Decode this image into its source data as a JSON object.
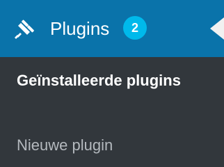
{
  "plugins_menu": {
    "label": "Plugins",
    "badge_count": "2",
    "icon": "plugin-icon",
    "submenu": {
      "installed": "Geïnstalleerde plugins",
      "new": "Nieuwe plugin"
    }
  },
  "colors": {
    "header_bg": "#0a73aa",
    "menu_bg": "#32373c",
    "badge_bg": "#00b9eb",
    "inactive_text": "#b4b9be",
    "active_text": "#ffffff"
  }
}
